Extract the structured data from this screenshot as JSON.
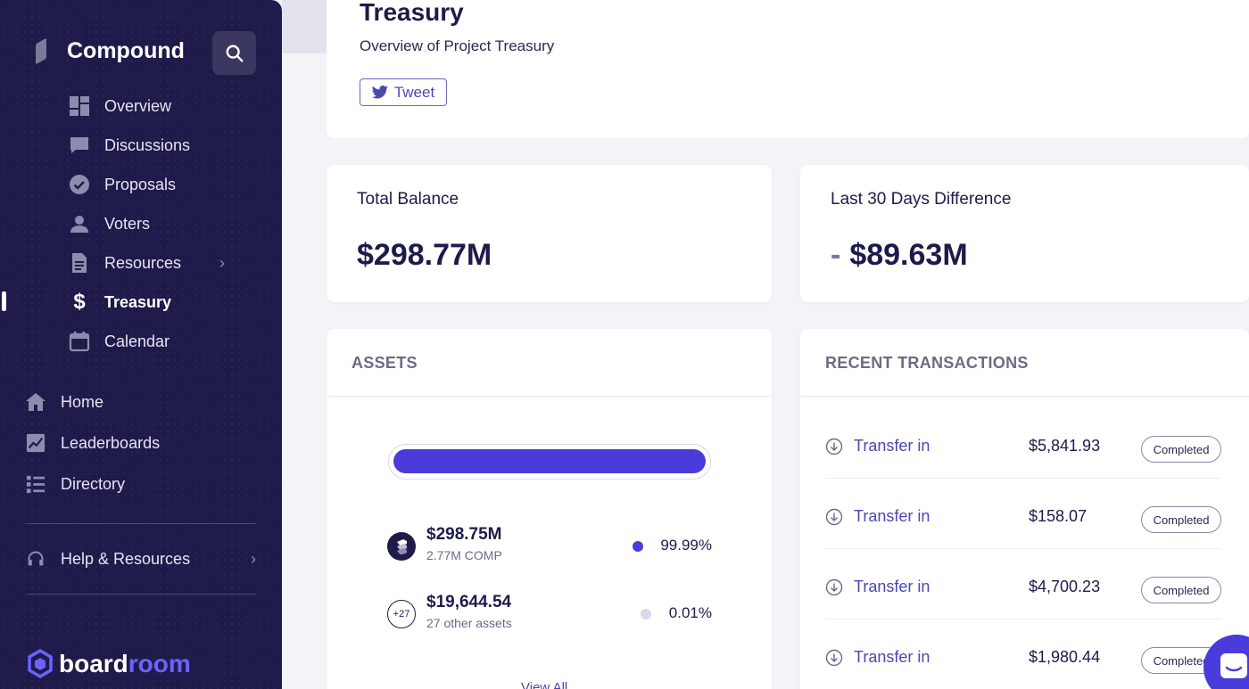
{
  "sidebar": {
    "brand": "Compound",
    "nav": [
      {
        "label": "Overview",
        "icon": "dashboard-icon"
      },
      {
        "label": "Discussions",
        "icon": "chat-icon"
      },
      {
        "label": "Proposals",
        "icon": "check-circle-icon"
      },
      {
        "label": "Voters",
        "icon": "users-icon"
      },
      {
        "label": "Resources",
        "icon": "document-icon"
      },
      {
        "label": "Treasury",
        "icon": "dollar-icon",
        "active": true
      },
      {
        "label": "Calendar",
        "icon": "calendar-icon"
      }
    ],
    "secondary": [
      {
        "label": "Home",
        "icon": "home-icon"
      },
      {
        "label": "Leaderboards",
        "icon": "chart-icon"
      },
      {
        "label": "Directory",
        "icon": "list-icon"
      }
    ],
    "help": "Help & Resources",
    "footer_brand": {
      "board": "board",
      "room": "room"
    }
  },
  "header": {
    "title": "Treasury",
    "subtitle": "Overview of Project Treasury",
    "tweet": "Tweet"
  },
  "stats": {
    "total_balance_label": "Total Balance",
    "total_balance_value": "$298.77M",
    "diff_label": "Last 30 Days Difference",
    "diff_sign": "-",
    "diff_value": "$89.63M"
  },
  "assets": {
    "title": "ASSETS",
    "progress_fraction": 0.9999,
    "items": [
      {
        "amount": "$298.75M",
        "sub": "2.77M COMP",
        "pct": "99.99%",
        "color": "#4a3cdb"
      },
      {
        "amount": "$19,644.54",
        "sub": "27 other assets",
        "pct": "0.01%",
        "color": "#d9d6ee",
        "badge": "+27"
      }
    ],
    "view_all": "View All"
  },
  "transactions": {
    "title": "RECENT TRANSACTIONS",
    "items": [
      {
        "type": "Transfer in",
        "amount": "$5,841.93",
        "status": "Completed"
      },
      {
        "type": "Transfer in",
        "amount": "$158.07",
        "status": "Completed"
      },
      {
        "type": "Transfer in",
        "amount": "$4,700.23",
        "status": "Completed"
      },
      {
        "type": "Transfer in",
        "amount": "$1,980.44",
        "status": "Completed"
      }
    ]
  },
  "colors": {
    "sidebar": "#1e1b4b",
    "accent": "#4a3cdb",
    "text": "#1d1b4a"
  }
}
